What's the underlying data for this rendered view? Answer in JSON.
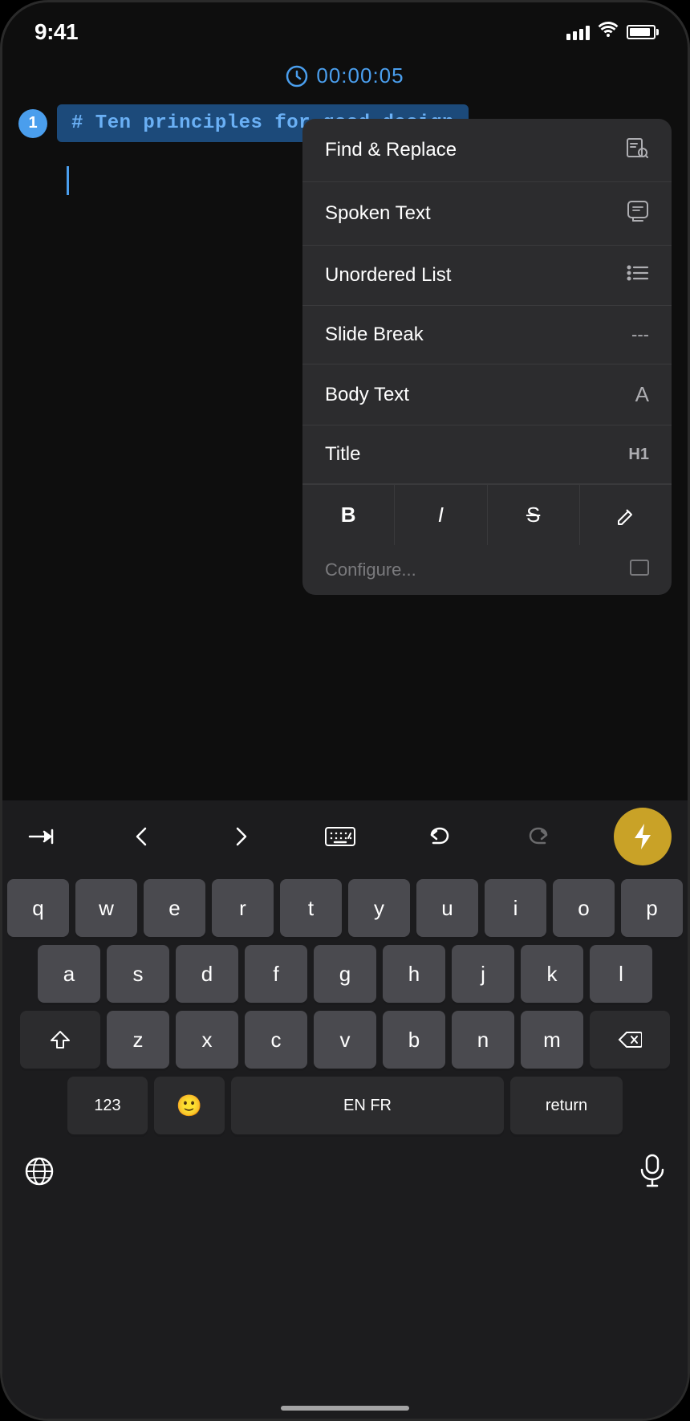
{
  "status_bar": {
    "time": "9:41",
    "battery_level": "90%"
  },
  "timer": {
    "label": "00:00:05"
  },
  "editor": {
    "line_number": "1",
    "heading": "# Ten principles for good design"
  },
  "context_menu": {
    "items": [
      {
        "label": "Find & Replace",
        "icon": "find-replace-icon",
        "shortcut": ""
      },
      {
        "label": "Spoken Text",
        "icon": "spoken-text-icon",
        "shortcut": ""
      },
      {
        "label": "Unordered List",
        "icon": "list-icon",
        "shortcut": ""
      },
      {
        "label": "Slide Break",
        "icon": "slide-break-icon",
        "shortcut": "---"
      },
      {
        "label": "Body Text",
        "icon": "body-text-icon",
        "shortcut": "A"
      },
      {
        "label": "Title",
        "icon": "title-icon",
        "shortcut": "H1"
      }
    ],
    "format_buttons": [
      {
        "label": "B",
        "style": "bold"
      },
      {
        "label": "I",
        "style": "italic"
      },
      {
        "label": "S",
        "style": "strikethrough"
      },
      {
        "label": "✏",
        "style": "edit"
      }
    ]
  },
  "toolbar": {
    "tab_icon": "→|",
    "left_arrow": "◀",
    "right_arrow": "▶",
    "keyboard_icon": "⌨",
    "undo_icon": "↩",
    "redo_icon": "↪",
    "lightning_icon": "⚡"
  },
  "keyboard": {
    "rows": [
      [
        "q",
        "w",
        "e",
        "r",
        "t",
        "y",
        "u",
        "i",
        "o",
        "p"
      ],
      [
        "a",
        "s",
        "d",
        "f",
        "g",
        "h",
        "j",
        "k",
        "l"
      ],
      [
        "z",
        "x",
        "c",
        "v",
        "b",
        "n",
        "m"
      ]
    ],
    "space_label": "EN FR",
    "return_label": "return",
    "numbers_label": "123"
  }
}
